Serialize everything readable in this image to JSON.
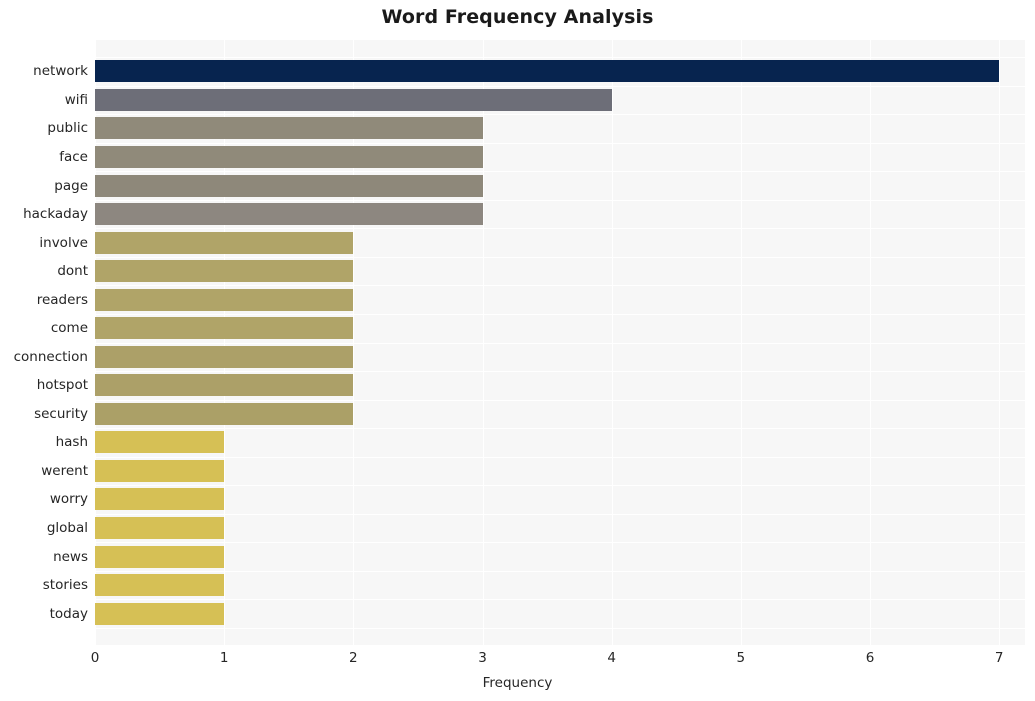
{
  "chart_data": {
    "type": "bar",
    "orientation": "horizontal",
    "title": "Word Frequency Analysis",
    "xlabel": "Frequency",
    "ylabel": "",
    "xlim": [
      0,
      7.2
    ],
    "xticks": [
      "0",
      "1",
      "2",
      "3",
      "4",
      "5",
      "6",
      "7"
    ],
    "xtick_values": [
      0,
      1,
      2,
      3,
      4,
      5,
      6,
      7
    ],
    "grid": true,
    "legend": null,
    "categories": [
      "network",
      "wifi",
      "public",
      "face",
      "page",
      "hackaday",
      "involve",
      "dont",
      "readers",
      "come",
      "connection",
      "hotspot",
      "security",
      "hash",
      "werent",
      "worry",
      "global",
      "news",
      "stories",
      "today"
    ],
    "values": [
      7,
      4,
      3,
      3,
      3,
      3,
      2,
      2,
      2,
      2,
      2,
      2,
      2,
      1,
      1,
      1,
      1,
      1,
      1,
      1
    ],
    "bar_colors": [
      "#07244f",
      "#6d6e78",
      "#908a7a",
      "#908a7a",
      "#8e887a",
      "#8d8780",
      "#b0a468",
      "#b0a468",
      "#b0a468",
      "#b0a468",
      "#aca068",
      "#aca068",
      "#aba067",
      "#d6c055",
      "#d6c055",
      "#d6c055",
      "#d6c055",
      "#d6c055",
      "#d6c055",
      "#d6c055"
    ],
    "plot_background": "#f7f7f7",
    "grid_color": "#ffffff",
    "figure_background": "#ffffff"
  }
}
